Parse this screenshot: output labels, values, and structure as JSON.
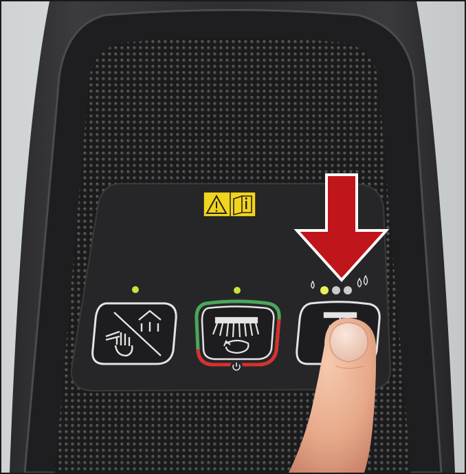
{
  "photo": {
    "subject": "machine-control-panel",
    "warning_label": {
      "icons": [
        "warning-triangle-icon",
        "manual-info-icon"
      ],
      "color": "#f2d41c"
    },
    "buttons": [
      {
        "id": "suction",
        "icon": "no-touch-suction-icon",
        "led_on": true,
        "led_color": "#c9e33a"
      },
      {
        "id": "brush",
        "icon": "brush-rotation-icon",
        "led_on": true,
        "led_color": "#c9e33a",
        "ring_colors": [
          "#49a85a",
          "#d8302f"
        ],
        "has_power_symbol": true
      },
      {
        "id": "water",
        "icon": "water-flow-icon",
        "led_count": 3,
        "leds_on": 1,
        "led_color": "#e8f05a"
      }
    ],
    "arrow_color": "#c0151b",
    "arrow_direction": "down",
    "finger_pressing": "water"
  }
}
